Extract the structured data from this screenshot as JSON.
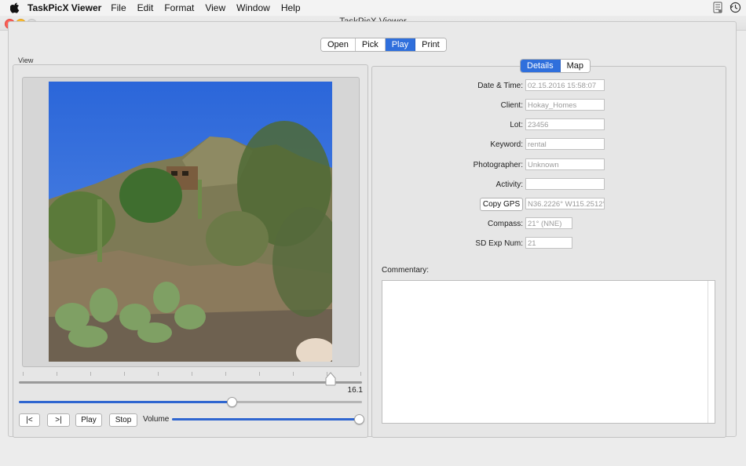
{
  "menubar": {
    "app_name": "TaskPicX Viewer",
    "items": [
      "File",
      "Edit",
      "Format",
      "View",
      "Window",
      "Help"
    ]
  },
  "window": {
    "title": "TaskPicX Viewer"
  },
  "top_tabs": [
    {
      "label": "Open",
      "selected": false
    },
    {
      "label": "Pick",
      "selected": false
    },
    {
      "label": "Play",
      "selected": true
    },
    {
      "label": "Print",
      "selected": false
    }
  ],
  "view_panel": {
    "label": "View",
    "slider_value_text": "16.1",
    "slider_fraction": 0.91,
    "playback_fraction": 0.62,
    "controls": {
      "prev_label": "|<",
      "next_label": ">|",
      "play_label": "Play",
      "stop_label": "Stop",
      "volume_label": "Volume",
      "volume_fraction": 1.0
    }
  },
  "details_tabs": [
    {
      "label": "Details",
      "selected": true
    },
    {
      "label": "Map",
      "selected": false
    }
  ],
  "fields": {
    "datetime": {
      "label": "Date & Time:",
      "value": "02.15.2016 15:58:07"
    },
    "client": {
      "label": "Client:",
      "value": "Hokay_Homes"
    },
    "lot": {
      "label": "Lot:",
      "value": "23456"
    },
    "keyword": {
      "label": "Keyword:",
      "value": "rental"
    },
    "photographer": {
      "label": "Photographer:",
      "value": "Unknown"
    },
    "activity": {
      "label": "Activity:",
      "value": ""
    },
    "gps": {
      "button_label": "Copy GPS",
      "value": "N36.2226° W115.2512°"
    },
    "compass": {
      "label": "Compass:",
      "value": "21° (NNE)"
    },
    "sd_exp": {
      "label": "SD Exp Num:",
      "value": "21"
    }
  },
  "commentary": {
    "label": "Commentary:",
    "value": ""
  },
  "colors": {
    "accent": "#2f6fdc",
    "slider_fill": "#2f66d0",
    "close": "#fc5f57",
    "minimize": "#fdbc2e"
  },
  "icons": [
    "apple-icon",
    "script-icon",
    "time-machine-icon"
  ]
}
